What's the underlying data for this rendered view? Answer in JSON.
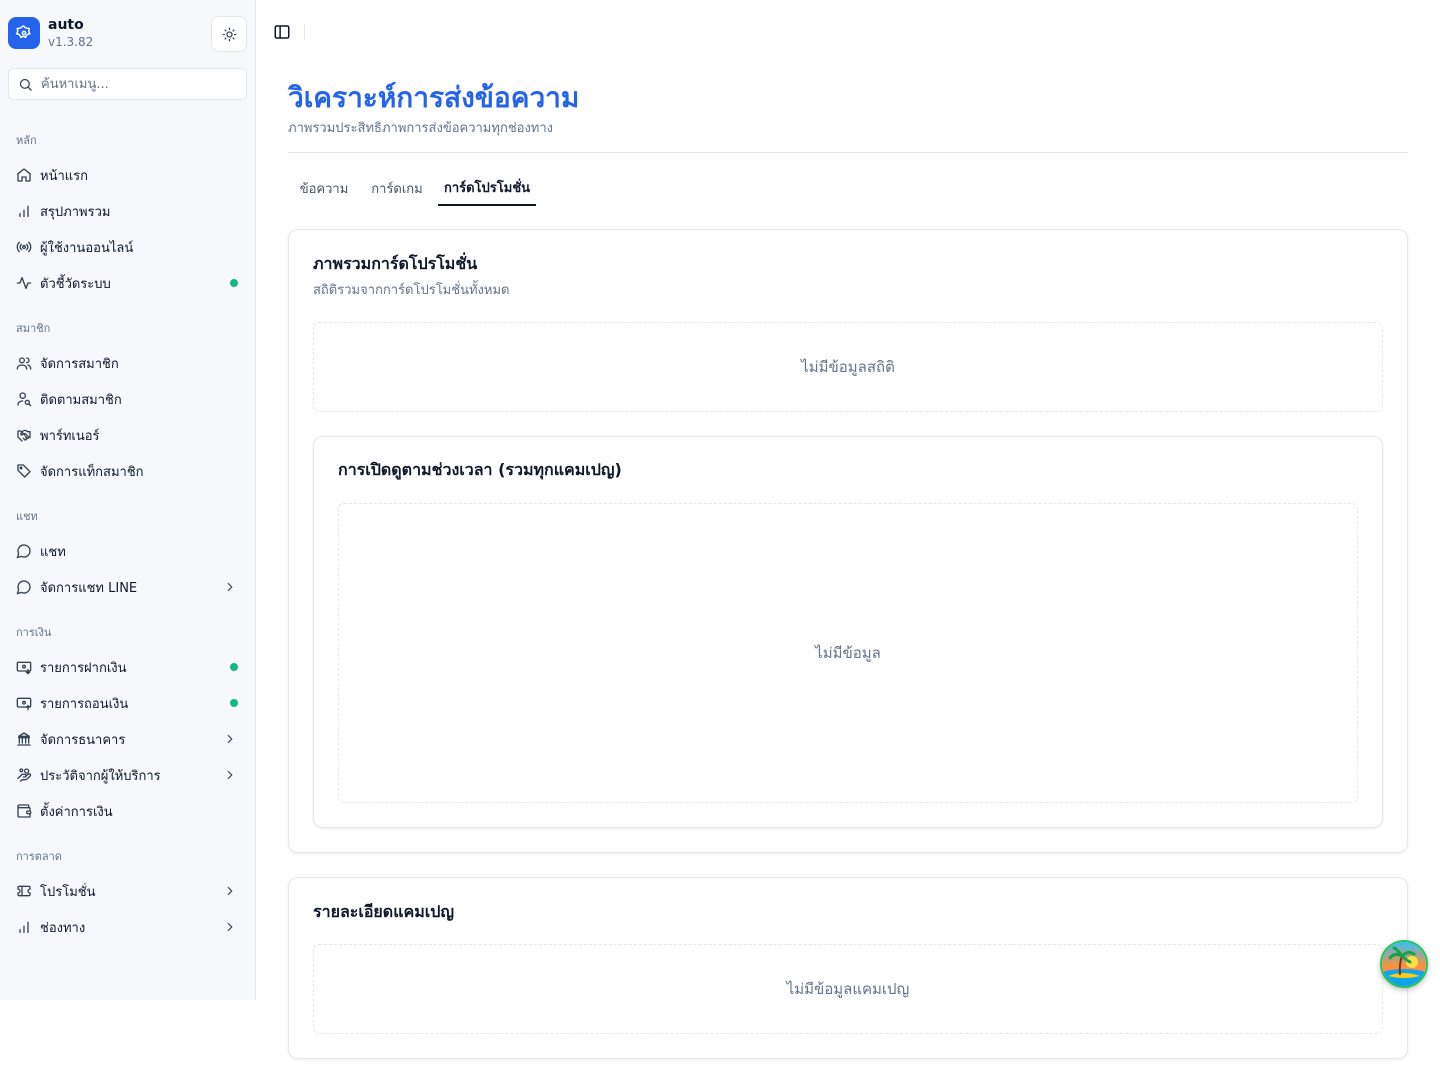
{
  "app": {
    "name": "auto",
    "version": "v1.3.82"
  },
  "search": {
    "placeholder": "ค้นหาเมนู...",
    "value": ""
  },
  "sidebar": {
    "groups": [
      {
        "label": "หลัก",
        "items": [
          {
            "label": "หน้าแรก",
            "icon": "home-icon"
          },
          {
            "label": "สรุปภาพรวม",
            "icon": "bar-chart-icon"
          },
          {
            "label": "ผู้ใช้งานออนไลน์",
            "icon": "radio-icon"
          },
          {
            "label": "ตัวชี้วัดระบบ",
            "icon": "activity-icon",
            "status_dot": true
          }
        ]
      },
      {
        "label": "สมาชิก",
        "items": [
          {
            "label": "จัดการสมาชิก",
            "icon": "users-icon"
          },
          {
            "label": "ติดตามสมาชิก",
            "icon": "user-search-icon"
          },
          {
            "label": "พาร์ทเนอร์",
            "icon": "handshake-icon"
          },
          {
            "label": "จัดการแท็กสมาชิก",
            "icon": "tag-icon"
          }
        ]
      },
      {
        "label": "แชท",
        "items": [
          {
            "label": "แชท",
            "icon": "message-circle-icon"
          },
          {
            "label": "จัดการแชท LINE",
            "icon": "message-circle-icon",
            "chevron": true
          }
        ]
      },
      {
        "label": "การเงิน",
        "items": [
          {
            "label": "รายการฝากเงิน",
            "icon": "deposit-icon",
            "status_dot": true
          },
          {
            "label": "รายการถอนเงิน",
            "icon": "withdraw-icon",
            "status_dot": true
          },
          {
            "label": "จัดการธนาคาร",
            "icon": "bank-icon",
            "chevron": true
          },
          {
            "label": "ประวัติจากผู้ให้บริการ",
            "icon": "hand-coins-icon",
            "chevron": true
          },
          {
            "label": "ตั้งค่าการเงิน",
            "icon": "wallet-icon"
          }
        ]
      },
      {
        "label": "การตลาด",
        "items": [
          {
            "label": "โปรโมชั่น",
            "icon": "ticket-icon",
            "chevron": true
          },
          {
            "label": "ช่องทาง",
            "icon": "bar-chart-icon",
            "chevron": true
          }
        ]
      }
    ]
  },
  "page": {
    "title": "วิเคราะห์การส่งข้อความ",
    "subtitle": "ภาพรวมประสิทธิภาพการส่งข้อความทุกช่องทาง"
  },
  "tabs": [
    {
      "label": "ข้อความ"
    },
    {
      "label": "การ์ดเกม"
    },
    {
      "label": "การ์ดโปรโมชั่น",
      "active": true
    }
  ],
  "overview_card": {
    "title": "ภาพรวมการ์ดโปรโมชั่น",
    "description": "สถิติรวมจากการ์ดโปรโมชั่นทั้งหมด",
    "empty_text": "ไม่มีข้อมูลสถิติ"
  },
  "views_card": {
    "title": "การเปิดดูตามช่วงเวลา (รวมทุกแคมเปญ)",
    "empty_text": "ไม่มีข้อมูล"
  },
  "campaign_card": {
    "title": "รายละเอียดแคมเปญ",
    "empty_text": "ไม่มีข้อมูลแคมเปญ"
  },
  "colors": {
    "accent": "#2563eb",
    "status_green": "#10b981",
    "sidebar_bg": "#f6f8fc"
  }
}
